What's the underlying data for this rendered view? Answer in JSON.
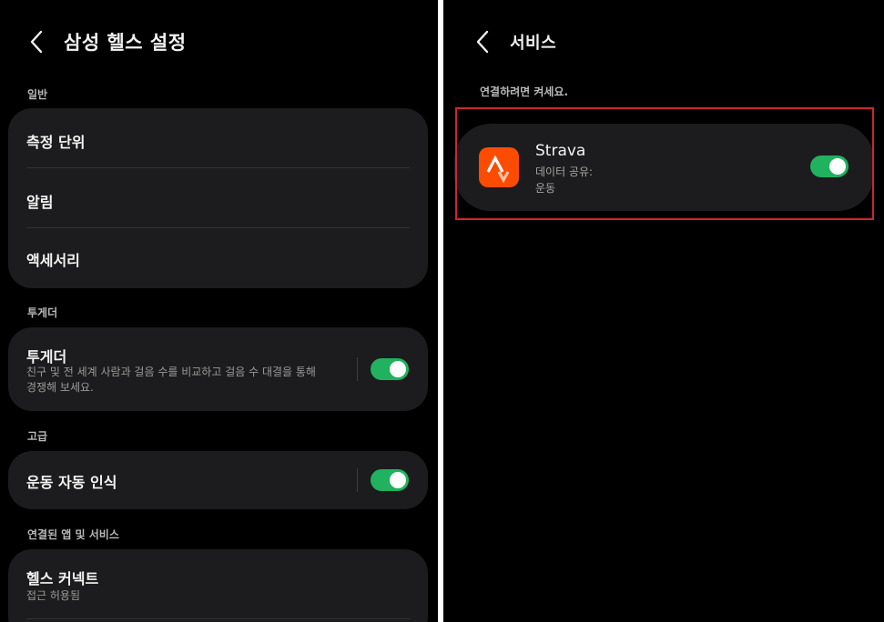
{
  "left": {
    "title": "삼성 헬스 설정",
    "sections": {
      "general": {
        "label": "일반",
        "items": [
          "측정 단위",
          "알림",
          "액세서리"
        ]
      },
      "together": {
        "label": "투게더",
        "item_title": "투게더",
        "item_desc_line1": "친구 및 전 세계 사람과 걸음 수를 비교하고 걸음 수 대결을 통해",
        "item_desc_line2": "경쟁해 보세요.",
        "toggle_on": true
      },
      "advanced": {
        "label": "고급",
        "item_title": "운동 자동 인식",
        "toggle_on": true
      },
      "connected": {
        "label": "연결된 앱 및 서비스",
        "item_title": "헬스 커넥트",
        "item_sub": "접근 허용됨"
      }
    }
  },
  "right": {
    "title": "서비스",
    "hint": "연결하려면 켜세요.",
    "service": {
      "name": "Strava",
      "line1": "데이터 공유:",
      "line2": "운동",
      "toggle_on": true
    }
  },
  "colors": {
    "background": "#000000",
    "card": "#1c1c1e",
    "toggle_on": "#20b25e",
    "highlight": "#d0262e",
    "strava": "#fc4c02"
  }
}
